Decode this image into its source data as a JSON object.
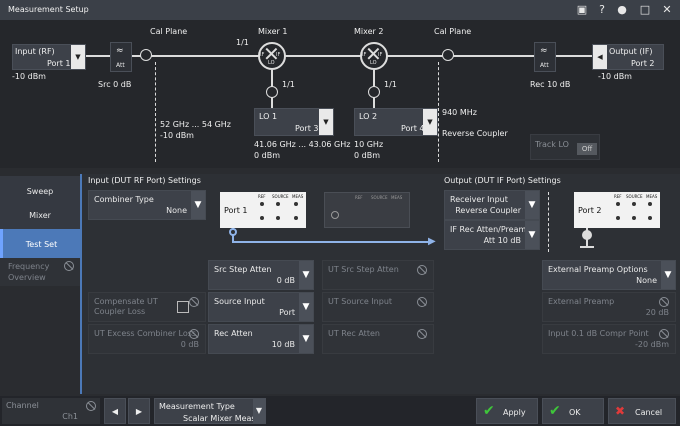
{
  "window": {
    "title": "Measurement Setup"
  },
  "diagram": {
    "input": {
      "label": "Input (RF)",
      "port": "Port 1",
      "power": "-10 dBm"
    },
    "src": {
      "att": "Att",
      "label": "Src 0 dB"
    },
    "cal_plane_left": "Cal Plane",
    "cal_plane_right": "Cal Plane",
    "cal_left_range": "52 GHz ... 54 GHz",
    "cal_left_power": "-10 dBm",
    "mixer1": {
      "label": "Mixer 1",
      "ratio": "1/1",
      "ratio_lo": "1/1",
      "lo_tag": "LO",
      "rf_tag": "RF",
      "if_tag": "IF"
    },
    "mixer2": {
      "label": "Mixer 2",
      "ratio_lo": "1/1",
      "lo_tag": "LO",
      "rf_tag": "RF",
      "if_tag": "IF"
    },
    "lo1": {
      "label": "LO 1",
      "port": "Port 3",
      "range": "41.06 GHz ... 43.06 GHz",
      "power": "0 dBm"
    },
    "lo2": {
      "label": "LO 2",
      "port": "Port 4",
      "freq": "10 GHz",
      "power": "0 dBm"
    },
    "right_freq": "940 MHz",
    "right_coupler": "Reverse Coupler",
    "rec": {
      "att": "Att",
      "label": "Rec 10 dB"
    },
    "output": {
      "label": "Output (IF)",
      "port": "Port 2",
      "power": "-10 dBm"
    },
    "track_lo": {
      "label": "Track LO",
      "state": "Off"
    }
  },
  "sidebar": {
    "items": [
      {
        "label": "Sweep"
      },
      {
        "label": "Mixer"
      },
      {
        "label": "Test Set"
      },
      {
        "label": "Frequency Overview"
      }
    ]
  },
  "rf_panel": {
    "title": "Input (DUT RF Port) Settings",
    "combiner": {
      "label": "Combiner Type",
      "value": "None"
    },
    "diag1_port": "Port 1",
    "diag_labels": {
      "ref": "REF",
      "source": "SOURCE",
      "meas": "MEAS",
      "out": "OUT",
      "in": "IN"
    },
    "src_step": {
      "label": "Src Step Atten",
      "value": "0 dB"
    },
    "ut_src_step": {
      "label": "UT Src Step Atten"
    },
    "compensate": {
      "label": "Compensate UT Coupler Loss"
    },
    "source_input": {
      "label": "Source Input",
      "value": "Port"
    },
    "ut_source_input": {
      "label": "UT Source Input"
    },
    "ut_excess": {
      "label": "UT Excess Combiner Loss",
      "value": "0 dB"
    },
    "rec_atten": {
      "label": "Rec Atten",
      "value": "10 dB"
    },
    "ut_rec_atten": {
      "label": "UT Rec Atten"
    }
  },
  "if_panel": {
    "title": "Output (DUT IF Port) Settings",
    "receiver": {
      "label": "Receiver Input",
      "value": "Reverse Coupler"
    },
    "if_rec": {
      "label": "IF Rec Atten/Preamp",
      "value": "Att 10 dB"
    },
    "port": "Port 2",
    "ext_preamp_opts": {
      "label": "External Preamp Options",
      "value": "None"
    },
    "ext_preamp": {
      "label": "External Preamp",
      "value": "20 dB"
    },
    "compr": {
      "label": "Input 0.1 dB Compr Point",
      "value": "-20 dBm"
    }
  },
  "bottom": {
    "channel": {
      "label": "Channel",
      "value": "Ch1"
    },
    "meas_type": {
      "label": "Measurement Type",
      "value": "Scalar Mixer Meas"
    },
    "apply": "Apply",
    "ok": "OK",
    "cancel": "Cancel"
  }
}
